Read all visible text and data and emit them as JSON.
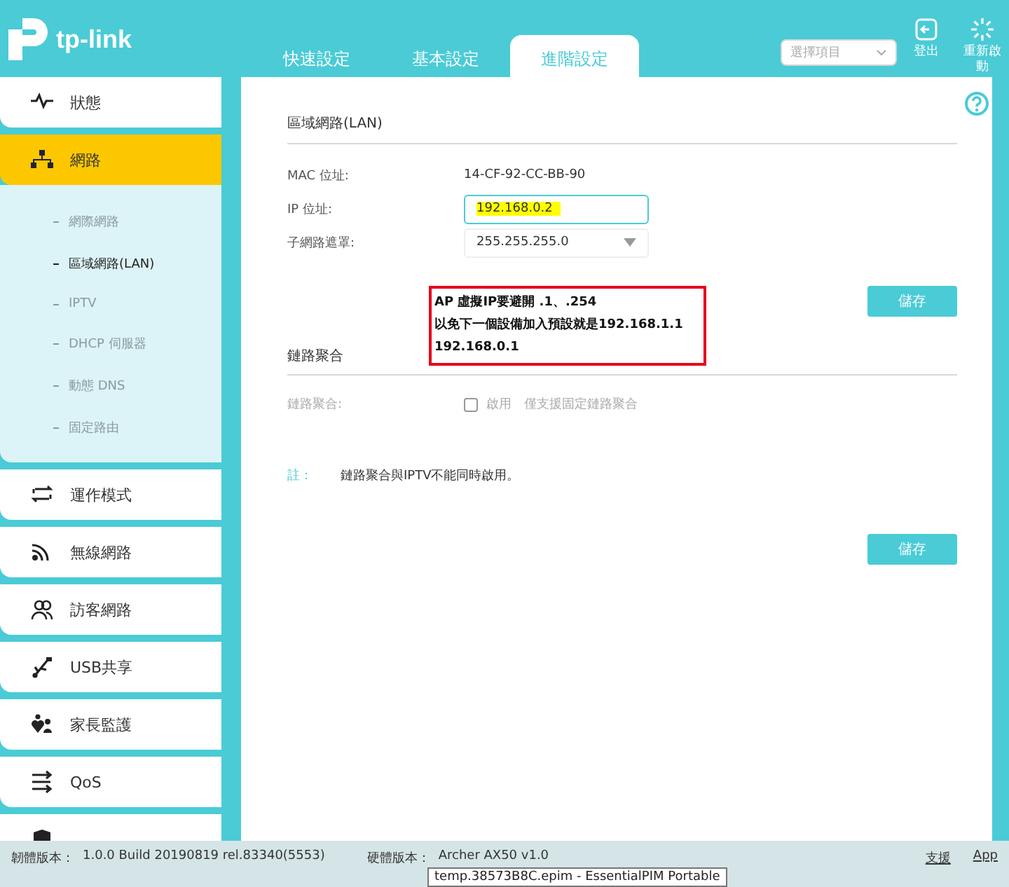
{
  "header": {
    "logo": "tp-link",
    "tabs": [
      {
        "label": "快速設定",
        "selected": false
      },
      {
        "label": "基本設定",
        "selected": false
      },
      {
        "label": "進階設定",
        "selected": true
      }
    ],
    "search_select": {
      "placeholder": "選擇項目"
    },
    "actions": [
      {
        "kind": "logout",
        "label": "登出"
      },
      {
        "kind": "reboot",
        "label": "重新啟動"
      }
    ]
  },
  "sidebar": {
    "items": [
      {
        "kind": "status",
        "label": "狀態",
        "selected": false
      },
      {
        "kind": "network",
        "label": "網路",
        "selected": true,
        "children": [
          {
            "label": "網際網路",
            "selected": false
          },
          {
            "label": "區域網路(LAN)",
            "selected": true
          },
          {
            "label": "IPTV",
            "selected": false
          },
          {
            "label": "DHCP 伺服器",
            "selected": false
          },
          {
            "label": "動態 DNS",
            "selected": false
          },
          {
            "label": "固定路由",
            "selected": false
          }
        ]
      },
      {
        "kind": "mode",
        "label": "運作模式",
        "selected": false
      },
      {
        "kind": "wireless",
        "label": "無線網路",
        "selected": false
      },
      {
        "kind": "guest",
        "label": "訪客網路",
        "selected": false
      },
      {
        "kind": "usb",
        "label": "USB共享",
        "selected": false
      },
      {
        "kind": "parental",
        "label": "家長監護",
        "selected": false
      },
      {
        "kind": "qos",
        "label": "QoS",
        "selected": false
      },
      {
        "kind": "security",
        "selected": false
      }
    ]
  },
  "lan": {
    "title": "區域網路(LAN)",
    "fields": [
      {
        "kind": "text",
        "label": "MAC 位址:",
        "value": "14-CF-92-CC-BB-90"
      },
      {
        "kind": "input",
        "label": "IP 位址:",
        "value": "192.168.0.2",
        "highlighted": true
      },
      {
        "kind": "select",
        "label": "子網路遮罩:",
        "value": "255.255.255.0"
      }
    ],
    "annotation": {
      "lines": [
        "AP 虛擬IP要避開 .1、.254",
        "以免下一個設備加入預設就是192.168.1.1",
        "192.168.0.1"
      ]
    },
    "save_button": "儲存"
  },
  "link_aggregation": {
    "title": "鏈路聚合",
    "label": "鏈路聚合:",
    "checkbox": {
      "label": "啟用",
      "checked": false,
      "disabled": true
    },
    "hint": "僅支援固定鏈路聚合",
    "note_label": "註：",
    "note": "鏈路聚合與IPTV不能同時啟用。",
    "save_button": "儲存"
  },
  "footer": {
    "firmware_label": "韌體版本：",
    "firmware": "1.0.0 Build 20190819 rel.83340(5553)",
    "hardware_label": "硬體版本：",
    "hardware": "Archer AX50 v1.0",
    "links": [
      "支援",
      "App"
    ]
  },
  "tooltip": "temp.38573B8C.epim - EssentialPIM Portable"
}
